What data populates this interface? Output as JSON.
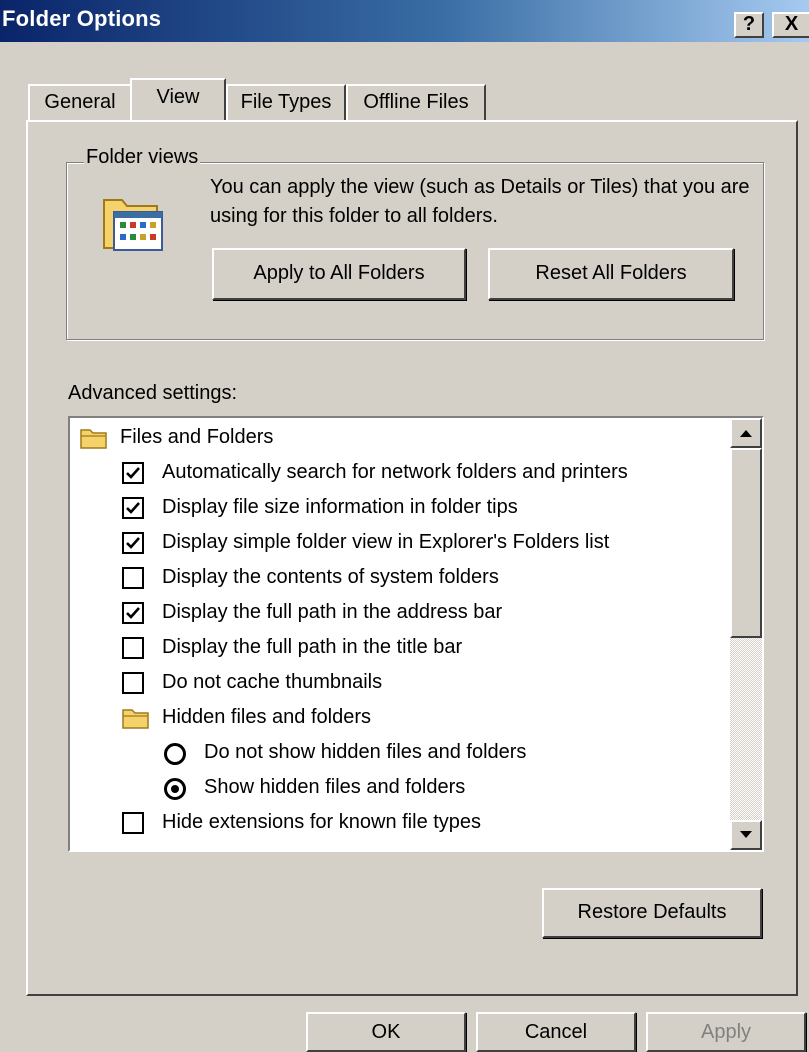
{
  "window": {
    "title": "Folder Options",
    "help_label": "?",
    "close_label": "X"
  },
  "tabs": [
    {
      "label": "General"
    },
    {
      "label": "View"
    },
    {
      "label": "File Types"
    },
    {
      "label": "Offline Files"
    }
  ],
  "active_tab": "View",
  "folder_views": {
    "legend": "Folder views",
    "description": "You can apply the view (such as Details or Tiles) that you are using for this folder to all folders.",
    "apply_button": "Apply to All Folders",
    "reset_button": "Reset All Folders",
    "icon": "folder-view-icon"
  },
  "advanced": {
    "label": "Advanced settings:",
    "items": [
      {
        "type": "folder",
        "label": "Files and Folders"
      },
      {
        "type": "checkbox",
        "label": "Automatically search for network folders and printers",
        "checked": true
      },
      {
        "type": "checkbox",
        "label": "Display file size information in folder tips",
        "checked": true
      },
      {
        "type": "checkbox",
        "label": "Display simple folder view in Explorer's Folders list",
        "checked": true
      },
      {
        "type": "checkbox",
        "label": "Display the contents of system folders",
        "checked": false
      },
      {
        "type": "checkbox",
        "label": "Display the full path in the address bar",
        "checked": true
      },
      {
        "type": "checkbox",
        "label": "Display the full path in the title bar",
        "checked": false
      },
      {
        "type": "checkbox",
        "label": "Do not cache thumbnails",
        "checked": false
      },
      {
        "type": "folder",
        "label": "Hidden files and folders"
      },
      {
        "type": "radio",
        "label": "Do not show hidden files and folders",
        "selected": false
      },
      {
        "type": "radio",
        "label": "Show hidden files and folders",
        "selected": true
      },
      {
        "type": "checkbox",
        "label": "Hide extensions for known file types",
        "checked": false
      }
    ],
    "restore_button": "Restore Defaults"
  },
  "footer": {
    "ok": "OK",
    "cancel": "Cancel",
    "apply": "Apply"
  },
  "colors": {
    "dialog_bg": "#d4d0c8",
    "title_gradient_start": "#0a246a",
    "title_gradient_end": "#a6caf0",
    "folder_yellow": "#f6d26b",
    "disabled_text": "#808080"
  }
}
